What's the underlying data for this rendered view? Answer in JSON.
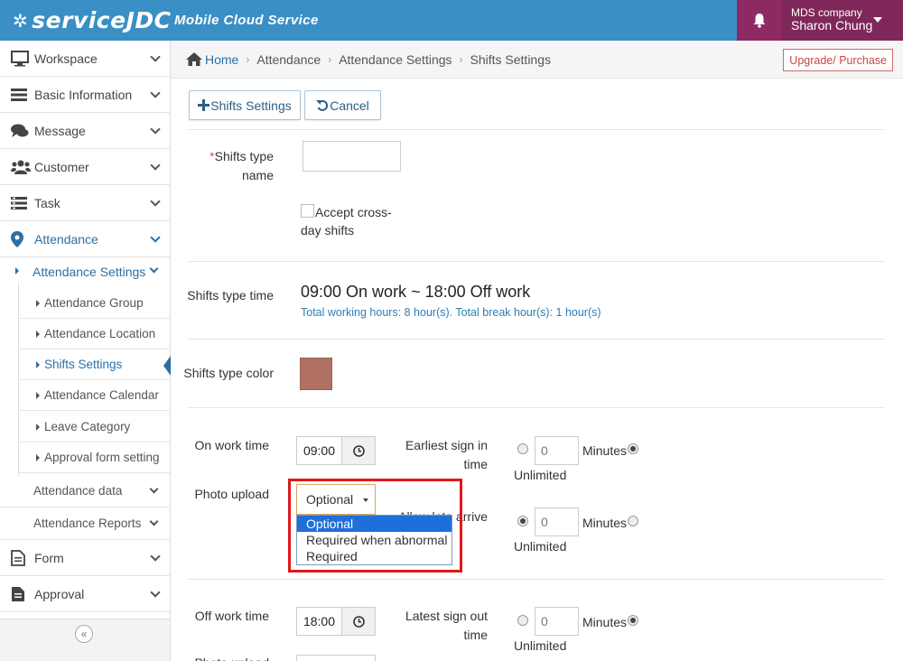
{
  "header": {
    "logo_text": "serviceJDC",
    "logo_subtitle": "Mobile Cloud Service",
    "company": "MDS company",
    "user_name": "Sharon Chung",
    "accent_color": "#3a8fc4",
    "user_box_color": "#7f275a"
  },
  "sidebar": {
    "items": [
      {
        "label": "Workspace",
        "icon": "monitor-icon"
      },
      {
        "label": "Basic Information",
        "icon": "list-icon"
      },
      {
        "label": "Message",
        "icon": "chat-icon"
      },
      {
        "label": "Customer",
        "icon": "users-icon"
      },
      {
        "label": "Task",
        "icon": "tasks-icon"
      },
      {
        "label": "Attendance",
        "icon": "location-pin-icon"
      }
    ],
    "attendance_settings": "Attendance Settings",
    "settings_children": [
      {
        "label": "Attendance Group"
      },
      {
        "label": "Attendance Location"
      },
      {
        "label": "Shifts Settings"
      },
      {
        "label": "Attendance Calendar"
      },
      {
        "label": "Leave Category"
      },
      {
        "label": "Approval form setting"
      }
    ],
    "attendance_data": "Attendance data",
    "attendance_reports": "Attendance Reports",
    "form": "Form",
    "approval": "Approval",
    "collapse_glyph": "«"
  },
  "breadcrumb": {
    "items": [
      "Home",
      "Attendance",
      "Attendance Settings",
      "Shifts Settings"
    ],
    "upgrade_label": "Upgrade/ Purchase"
  },
  "toolbar": {
    "shifts_settings_label": "Shifts Settings",
    "cancel_label": "Cancel"
  },
  "form": {
    "shift_name_label": "Shifts type name",
    "shift_name_value": "",
    "required_mark": "*",
    "cross_day_label": "Accept cross-day shifts",
    "cross_day_checked": false,
    "shift_time_label": "Shifts type time",
    "shift_time_value": "09:00 On work ~ 18:00 Off work",
    "hours_info": "Total working hours: 8 hour(s). Total break hour(s): 1 hour(s)",
    "color_label": "Shifts type color",
    "color_value": "#b07162",
    "on_work_label": "On work time",
    "on_work_value": "09:00",
    "earliest_sign_in_label": "Earliest sign in time",
    "earliest_value": "0",
    "minutes": "Minutes",
    "unlimited": "Unlimited",
    "photo_upload_label": "Photo upload",
    "photo_upload_selected": "Optional",
    "photo_upload_options": [
      "Optional",
      "Required when abnormal",
      "Required"
    ],
    "allow_late_label": "Allow late arrive",
    "late_value": "0",
    "off_work_label": "Off work time",
    "off_work_value": "18:00",
    "latest_sign_out_label": "Latest sign out time",
    "latest_value": "0",
    "photo_upload_label_2": "Photo upload"
  }
}
